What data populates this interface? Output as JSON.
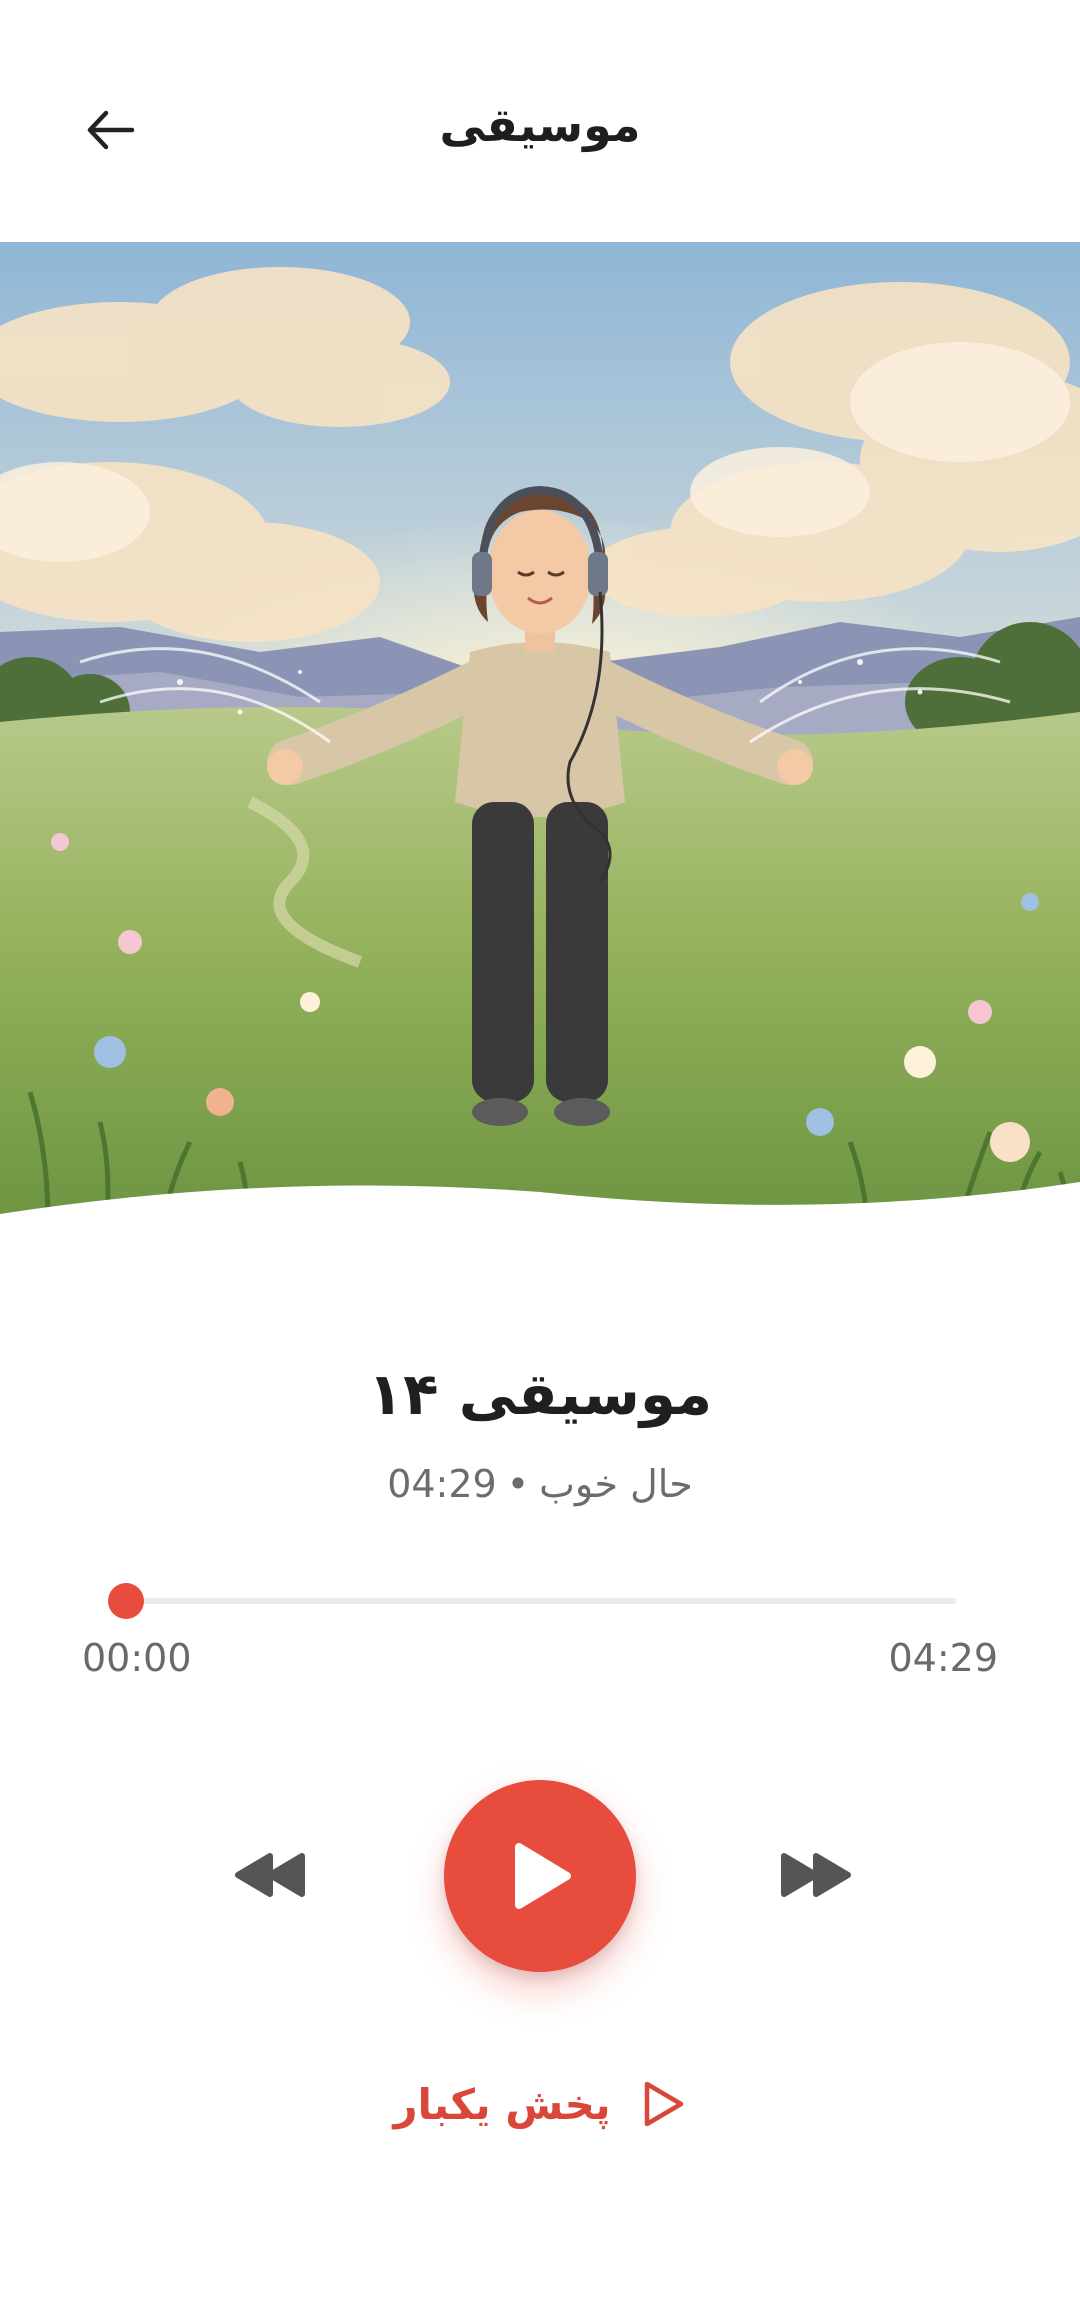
{
  "header": {
    "title": "موسیقی",
    "back_icon": "arrow-left-icon"
  },
  "artwork": {
    "alt": "موسیقی ۱۴"
  },
  "track": {
    "title": "موسیقی ۱۴",
    "category": "حال خوب",
    "separator": "•",
    "duration": "04:29"
  },
  "progress": {
    "current_time": "00:00",
    "total_time": "04:29",
    "fraction": 0.0
  },
  "controls": {
    "rewind_icon": "rewind-icon",
    "play_icon": "play-icon",
    "forward_icon": "fast-forward-icon"
  },
  "play_once": {
    "label": "پخش یکبار",
    "icon": "play-outline-icon"
  },
  "colors": {
    "accent": "#e74c3c",
    "text_primary": "#1f1f1f",
    "text_secondary": "#6c6c6c",
    "control_icon": "#555555"
  }
}
